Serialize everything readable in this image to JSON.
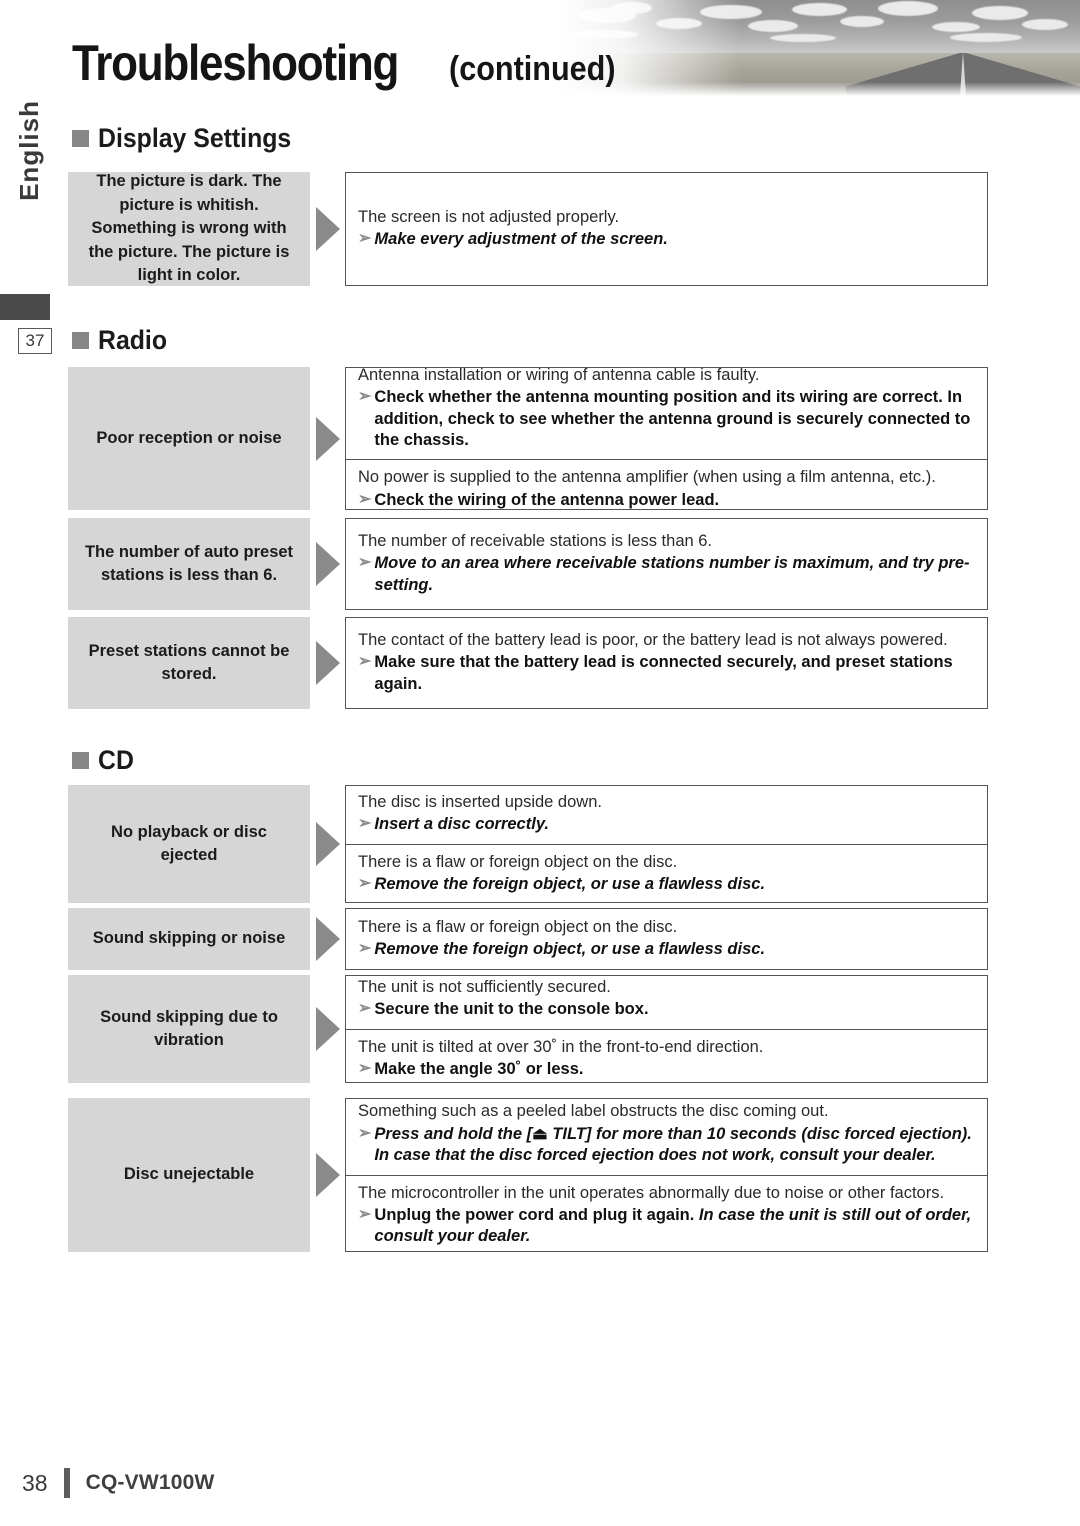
{
  "header": {
    "title_main": "Troubleshooting",
    "title_continued": "(continued)",
    "banner_icon": "road-landscape-photo"
  },
  "sidebar": {
    "language_label": "English",
    "page_marker": "37"
  },
  "sections": [
    {
      "id": "display-settings",
      "heading": "Display Settings",
      "rows": [
        {
          "symptom": "The picture is dark. The picture is whitish. Something is wrong with the picture. The picture is light in color.",
          "causes": [
            {
              "cause": "The screen is not adjusted properly.",
              "fix": "Make every adjustment of the screen.",
              "fix_style": "italic"
            }
          ]
        }
      ]
    },
    {
      "id": "radio",
      "heading": "Radio",
      "rows": [
        {
          "symptom": "Poor reception or noise",
          "causes": [
            {
              "cause": "Antenna installation or wiring of antenna cable is faulty.",
              "fix": "Check whether the antenna mounting position and its wiring are correct. In addition, check to see whether the antenna ground is securely connected to the chassis.",
              "fix_style": "bold"
            },
            {
              "cause": "No power is supplied to the antenna amplifier (when using a film antenna, etc.).",
              "fix": "Check the wiring of the antenna power lead.",
              "fix_style": "bold"
            }
          ]
        },
        {
          "symptom": "The number of auto preset stations is less than 6.",
          "causes": [
            {
              "cause": "The number of receivable stations is less than 6.",
              "fix": "Move to an area where receivable stations number is maximum, and try pre-setting.",
              "fix_style": "italic"
            }
          ]
        },
        {
          "symptom": "Preset stations cannot be stored.",
          "causes": [
            {
              "cause": "The contact of the battery lead is poor, or the battery lead is not always powered.",
              "fix": "Make sure that the battery lead is connected securely, and preset stations again.",
              "fix_style": "bold"
            }
          ]
        }
      ]
    },
    {
      "id": "cd",
      "heading": "CD",
      "rows": [
        {
          "symptom": "No playback or disc ejected",
          "causes": [
            {
              "cause": "The disc is inserted upside down.",
              "fix": "Insert a disc correctly.",
              "fix_style": "italic"
            },
            {
              "cause": "There is a flaw or foreign object on the disc.",
              "fix": "Remove the foreign object, or use a flawless disc.",
              "fix_style": "italic"
            }
          ]
        },
        {
          "symptom": "Sound skipping or noise",
          "causes": [
            {
              "cause": "There is a flaw or foreign object on the disc.",
              "fix": "Remove the foreign object, or use a flawless disc.",
              "fix_style": "italic"
            }
          ]
        },
        {
          "symptom": "Sound skipping due to vibration",
          "causes": [
            {
              "cause": "The unit is not sufficiently secured.",
              "fix": "Secure the unit to the console box.",
              "fix_style": "bold"
            },
            {
              "cause": "The unit is tilted at over 30˚ in the front-to-end direction.",
              "fix": "Make the angle 30˚ or less.",
              "fix_style": "bold"
            }
          ]
        },
        {
          "symptom": "Disc unejectable",
          "causes": [
            {
              "cause": "Something such as a peeled label obstructs the disc coming out.",
              "fix_parts": [
                {
                  "text": "Press and hold the [",
                  "style": "bold-italic"
                },
                {
                  "text": "⏏",
                  "style": "eject-icon"
                },
                {
                  "text": " TILT] for more than 10 seconds (disc forced ejection). In case that the disc forced ejection does not work, consult your dealer.",
                  "style": "bold-italic"
                }
              ]
            },
            {
              "cause": "The microcontroller in the unit operates abnormally due to noise or other factors.",
              "fix_parts": [
                {
                  "text": "Unplug the power cord and plug it again. ",
                  "style": "bold"
                },
                {
                  "text": "In case the unit is still out of order, consult your dealer.",
                  "style": "bold-italic"
                }
              ]
            }
          ]
        }
      ]
    }
  ],
  "footer": {
    "page_number": "38",
    "model": "CQ-VW100W"
  },
  "colors": {
    "symptom_bg": "#d6d6d6",
    "bullet": "#878787",
    "arrow": "#8a8a8a",
    "border": "#555555",
    "sidebar_bar": "#4a4a4a"
  }
}
